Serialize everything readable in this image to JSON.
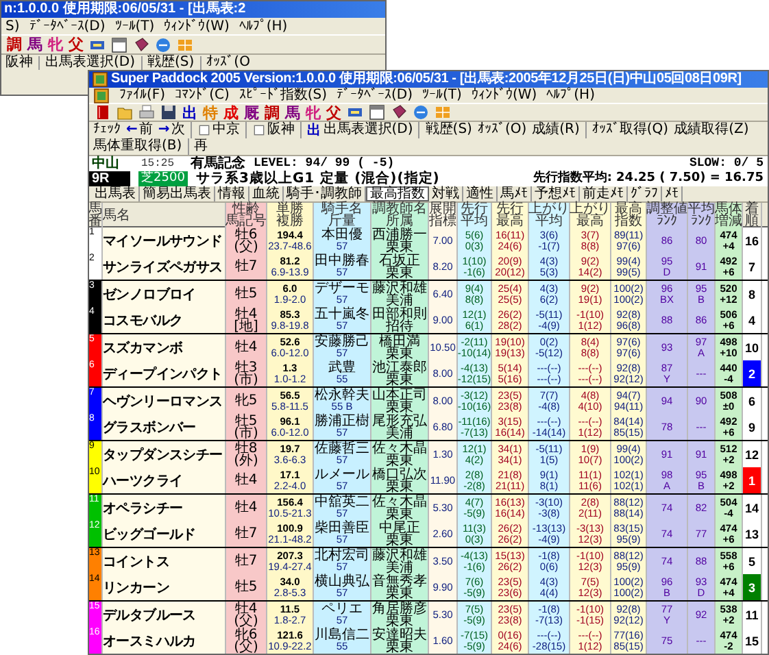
{
  "back_window": {
    "title": "n:1.0.0.0 使用期限:06/05/31 - [出馬表:2",
    "menu": [
      "S)",
      "ﾃﾞｰﾀﾍﾞｰｽ(D)",
      "ﾂｰﾙ(T)",
      "ｳｨﾝﾄﾞｳ(W)",
      "ﾍﾙﾌﾟ(H)"
    ],
    "toolbar": [
      {
        "text": "調",
        "color": "#c00000"
      },
      {
        "text": "馬",
        "color": "#800080"
      },
      {
        "text": "牝",
        "color": "#d02080"
      },
      {
        "text": "父",
        "color": "#c00000"
      }
    ],
    "toolbar2": [
      "阪神",
      "出馬表選択(D)",
      "戦歴(S)",
      "ｵｯｽﾞ(O"
    ]
  },
  "window": {
    "title": "Super Paddock 2005 Version:1.0.0.0 使用期限:06/05/31 - [出馬表:2005年12月25日(日)中山05回08日09R]",
    "menu": [
      "ﾌｧｲﾙ(F)",
      "ｺﾏﾝﾄﾞ(C)",
      "ｽﾋﾟｰﾄﾞ指数(S)",
      "ﾃﾞｰﾀﾍﾞｰｽ(D)",
      "ﾂｰﾙ(T)",
      "ｳｨﾝﾄﾞｳ(W)",
      "ﾍﾙﾌﾟ(H)"
    ],
    "toolbar": [
      {
        "text": "出",
        "color": "#0000c0"
      },
      {
        "text": "特",
        "color": "#e08000"
      },
      {
        "text": "成",
        "color": "#e00000"
      },
      {
        "text": "厩",
        "color": "#800080"
      },
      {
        "text": "調",
        "color": "#c00000"
      },
      {
        "text": "馬",
        "color": "#800080"
      },
      {
        "text": "牝",
        "color": "#d02080"
      },
      {
        "text": "父",
        "color": "#c00000"
      }
    ],
    "toolbar2": [
      {
        "kind": "plain",
        "text": "ﾁｪｯｸ",
        "separated": false
      },
      {
        "kind": "nav",
        "arrow": "←",
        "text": "前",
        "separated": false
      },
      {
        "kind": "nav",
        "arrow": "→",
        "text": "次",
        "separated": false
      },
      {
        "kind": "venue",
        "text": "中京",
        "separated": true
      },
      {
        "kind": "venue",
        "text": "阪神",
        "separated": true
      },
      {
        "kind": "select",
        "glyph": "出",
        "text": "出馬表選択(D)",
        "separated": true
      },
      {
        "kind": "plain",
        "text": "戦歴(S)",
        "separated": true
      },
      {
        "kind": "plain",
        "text": "ｵｯｽﾞ(O)",
        "separated": false
      },
      {
        "kind": "plain",
        "text": "成績(R)",
        "separated": false
      },
      {
        "kind": "plain",
        "text": "ｵｯｽﾞ取得(Q)",
        "separated": true
      },
      {
        "kind": "plain",
        "text": "成績取得(Z)",
        "separated": false
      },
      {
        "kind": "plain",
        "text": "馬体重取得(B)",
        "separated": false
      },
      {
        "kind": "plain",
        "text": "再",
        "separated": true
      }
    ],
    "info": {
      "venue": "中山",
      "time": "15:25",
      "race_name": "有馬記念",
      "level": "LEVEL: 94/ 99 ( -5)",
      "slow": "SLOW: 0/ 5",
      "race_no": "9R",
      "course": "芝2500",
      "condition": "サラ系3歳以上G1 定量 (混合)(指定)",
      "lead_index": "先行指数平均: 24.25 ( 7.50) = 16.75"
    },
    "tabs": [
      {
        "label": "出馬表",
        "selected": false
      },
      {
        "label": "簡易出馬表",
        "selected": false
      },
      {
        "label": "情報",
        "selected": false
      },
      {
        "label": "血統",
        "selected": false
      },
      {
        "label": "騎手･調教師",
        "selected": false
      },
      {
        "label": "最高指数",
        "selected": true
      },
      {
        "label": "対戦",
        "selected": false
      },
      {
        "label": "適性",
        "selected": false
      },
      {
        "label": "馬ﾒﾓ",
        "selected": false
      },
      {
        "label": "予想ﾒﾓ",
        "selected": false
      },
      {
        "label": "前走ﾒﾓ",
        "selected": false
      },
      {
        "label": "ｸﾞﾗﾌ",
        "selected": false
      },
      {
        "label": "ﾒﾓ",
        "selected": false
      }
    ],
    "table": {
      "columns": [
        [
          "馬",
          "番"
        ],
        [
          "馬名"
        ],
        [
          "性齢",
          "馬記号"
        ],
        [
          "単勝",
          "複勝"
        ],
        [
          "騎手名",
          "斤量"
        ],
        [
          "調教師名",
          "所属"
        ],
        [
          "展開",
          "指標"
        ],
        [
          "先行",
          "平均"
        ],
        [
          "先行",
          "最高"
        ],
        [
          "上がり",
          "平均"
        ],
        [
          "上がり",
          "最高"
        ],
        [
          "最高",
          "指数"
        ],
        [
          "調整値",
          "ﾗﾝｸ"
        ],
        [
          "平均",
          "ﾗﾝｸ"
        ],
        [
          "馬体",
          "増減"
        ],
        [
          "着",
          "順"
        ]
      ],
      "rows": [
        {
          "number": "1",
          "color": "#ffffff",
          "name": "マイソールサウンド",
          "sex_age": "牡6",
          "origin": "(父)",
          "odds_win": "194.4",
          "odds_place": "23.7-48.6",
          "jockey": "本田優",
          "weight": "57",
          "trainer": "西浦勝一",
          "stable": "栗東",
          "pace": "7.00",
          "lead_avg": [
            "5(6)",
            "0(3)"
          ],
          "lead_max": [
            "16(11)",
            "24(6)"
          ],
          "final_avg": [
            "3(6)",
            "-1(7)"
          ],
          "final_max": [
            "3(7)",
            "8(8)"
          ],
          "max_index": [
            "89(11)",
            "97(6)"
          ],
          "adj_rank": "86",
          "avg_rank": "80",
          "body_weight": "474",
          "weight_change": "+4",
          "finish": {
            "text": "16"
          }
        },
        {
          "number": "2",
          "color": "#ffffff",
          "name": "サンライズペガサス",
          "sex_age": "牡7",
          "odds_win": "81.2",
          "odds_place": "6.9-13.9",
          "jockey": "田中勝春",
          "weight": "57",
          "trainer": "石坂正",
          "stable": "栗東",
          "pace": "8.20",
          "lead_avg": [
            "1(10)",
            "-1(6)"
          ],
          "lead_max": [
            "20(9)",
            "20(12)"
          ],
          "final_avg": [
            "4(3)",
            "5(3)"
          ],
          "final_max": [
            "9(2)",
            "14(2)"
          ],
          "max_index": [
            "99(4)",
            "99(5)"
          ],
          "adj_rank": "95",
          "adj_grade": "D",
          "avg_rank": "91",
          "body_weight": "492",
          "weight_change": "+6",
          "finish": {
            "text": "7"
          }
        },
        {
          "number": "3",
          "color": "#000000",
          "name": "ゼンノロブロイ",
          "sex_age": "牡5",
          "odds_win": "6.0",
          "odds_place": "1.9-2.0",
          "jockey": "デザーモ",
          "weight": "57",
          "trainer": "藤沢和雄",
          "stable": "美浦",
          "pace": "6.40",
          "lead_avg": [
            "9(4)",
            "8(8)"
          ],
          "lead_max": [
            "25(4)",
            "25(5)"
          ],
          "final_avg": [
            "4(3)",
            "6(2)"
          ],
          "final_max": [
            "9(2)",
            "19(1)"
          ],
          "max_index": [
            "100(2)",
            "100(2)"
          ],
          "adj_rank": "96",
          "adj_grade": "BX",
          "avg_rank": "95",
          "avg_grade": "B",
          "body_weight": "520",
          "weight_change": "+12",
          "finish": {
            "text": "8"
          }
        },
        {
          "number": "4",
          "color": "#000000",
          "name": "コスモバルク",
          "sex_age": "牡4",
          "origin": "[地]",
          "odds_win": "85.3",
          "odds_place": "9.8-19.8",
          "jockey": "五十嵐冬",
          "weight": "57",
          "trainer": "田部和則",
          "stable": "招待",
          "pace": "9.00",
          "lead_avg": [
            "12(1)",
            "6(1)"
          ],
          "lead_max": [
            "26(2)",
            "28(2)"
          ],
          "final_avg": [
            "-5(11)",
            "-4(9)"
          ],
          "final_max": [
            "-1(10)",
            "1(12)"
          ],
          "max_index": [
            "92(8)",
            "96(8)"
          ],
          "adj_rank": "88",
          "avg_rank": "86",
          "body_weight": "506",
          "weight_change": "+6",
          "finish": {
            "text": "4"
          }
        },
        {
          "number": "5",
          "color": "#ff0000",
          "name": "スズカマンボ",
          "sex_age": "牡4",
          "odds_win": "52.6",
          "odds_place": "6.0-12.0",
          "jockey": "安藤勝己",
          "weight": "57",
          "trainer": "橋田満",
          "stable": "栗東",
          "pace": "10.50",
          "lead_avg": [
            "-2(11)",
            "-10(14)"
          ],
          "lead_max": [
            "19(10)",
            "19(13)"
          ],
          "final_avg": [
            "0(2)",
            "-5(12)"
          ],
          "final_max": [
            "8(4)",
            "8(8)"
          ],
          "max_index": [
            "97(6)",
            "97(6)"
          ],
          "adj_rank": "93",
          "avg_rank": "97",
          "avg_grade": "A",
          "body_weight": "498",
          "weight_change": "+10",
          "finish": {
            "text": "10"
          }
        },
        {
          "number": "6",
          "color": "#ff0000",
          "name": "ディープインパクト",
          "sex_age": "牡3",
          "origin": "(市)",
          "odds_win": "1.3",
          "odds_place": "1.0-1.2",
          "jockey": "武豊",
          "weight": "55",
          "trainer": "池江泰郎",
          "stable": "栗東",
          "pace": "8.00",
          "lead_avg": [
            "-4(13)",
            "-12(15)"
          ],
          "lead_max": [
            "5(14)",
            "5(16)"
          ],
          "final_avg": [
            "---(--)",
            "---(--)"
          ],
          "final_max": [
            "---(--)",
            "---(--)"
          ],
          "max_index": [
            "92(8)",
            "92(12)"
          ],
          "adj_rank": "87",
          "adj_grade": "Y",
          "avg_rank": "---",
          "body_weight": "440",
          "weight_change": "-4",
          "finish": {
            "text": "2",
            "color": "#0000ff"
          }
        },
        {
          "number": "7",
          "color": "#0000ff",
          "name": "ヘヴンリーロマンス",
          "sex_age": "牝5",
          "odds_win": "56.5",
          "odds_place": "5.8-11.5",
          "jockey": "松永幹夫",
          "weight": "55 B",
          "trainer": "山本正司",
          "stable": "栗東",
          "pace": "8.00",
          "lead_avg": [
            "-3(12)",
            "-10(16)"
          ],
          "lead_max": [
            "23(5)",
            "23(8)"
          ],
          "final_avg": [
            "7(7)",
            "-4(8)"
          ],
          "final_max": [
            "4(8)",
            "4(10)"
          ],
          "max_index": [
            "94(7)",
            "94(11)"
          ],
          "adj_rank": "94",
          "avg_rank": "90",
          "body_weight": "508",
          "weight_change": "±0",
          "finish": {
            "text": "6"
          }
        },
        {
          "number": "8",
          "color": "#0000ff",
          "name": "グラスボンバー",
          "sex_age": "牡5",
          "origin": "(市)",
          "odds_win": "96.1",
          "odds_place": "6.0-12.0",
          "jockey": "勝浦正樹",
          "weight": "57",
          "trainer": "尾形充弘",
          "stable": "美浦",
          "pace": "6.80",
          "lead_avg": [
            "-11(16)",
            "-7(13)"
          ],
          "lead_max": [
            "3(15)",
            "16(14)"
          ],
          "final_avg": [
            "---(--)",
            "-14(14)"
          ],
          "final_max": [
            "---(--)",
            "1(12)"
          ],
          "max_index": [
            "84(14)",
            "85(15)"
          ],
          "adj_rank": "78",
          "avg_rank": "---",
          "body_weight": "492",
          "weight_change": "+6",
          "finish": {
            "text": "9"
          }
        },
        {
          "number": "9",
          "color": "#ffff00",
          "name": "タップダンスシチー",
          "sex_age": "牡8",
          "origin": "(外)",
          "odds_win": "19.7",
          "odds_place": "3.6-6.3",
          "jockey": "佐藤哲三",
          "weight": "57",
          "trainer": "佐々木晶",
          "stable": "栗東",
          "pace": "1.30",
          "lead_avg": [
            "12(1)",
            "4(2)"
          ],
          "lead_max": [
            "34(1)",
            "34(1)"
          ],
          "final_avg": [
            "-5(11)",
            "1(5)"
          ],
          "final_max": [
            "1(9)",
            "10(7)"
          ],
          "max_index": [
            "99(4)",
            "100(2)"
          ],
          "adj_rank": "91",
          "avg_rank": "91",
          "body_weight": "512",
          "weight_change": "+2",
          "finish": {
            "text": "12"
          }
        },
        {
          "number": "10",
          "color": "#ffff00",
          "name": "ハーツクライ",
          "sex_age": "牡4",
          "odds_win": "17.1",
          "odds_place": "2.2-4.0",
          "jockey": "ルメール",
          "weight": "57",
          "trainer": "橋口弘次",
          "stable": "栗東",
          "pace": "11.90",
          "lead_avg": [
            "2(8)",
            "-2(8)"
          ],
          "lead_max": [
            "21(8)",
            "21(11)"
          ],
          "final_avg": [
            "9(1)",
            "8(1)"
          ],
          "final_max": [
            "11(1)",
            "11(6)"
          ],
          "max_index": [
            "102(1)",
            "102(1)"
          ],
          "adj_rank": "98",
          "adj_grade": "A",
          "avg_rank": "95",
          "avg_grade": "B",
          "body_weight": "498",
          "weight_change": "+2",
          "finish": {
            "text": "1",
            "color": "#ff0000"
          }
        },
        {
          "number": "11",
          "color": "#00c000",
          "name": "オペラシチー",
          "sex_age": "牡4",
          "odds_win": "156.4",
          "odds_place": "10.5-21.3",
          "jockey": "中舘英二",
          "weight": "57",
          "trainer": "佐々木晶",
          "stable": "栗東",
          "pace": "5.30",
          "lead_avg": [
            "4(7)",
            "-5(9)"
          ],
          "lead_max": [
            "16(13)",
            "16(14)"
          ],
          "final_avg": [
            "-3(10)",
            "-3(8)"
          ],
          "final_max": [
            "2(8)",
            "2(11)"
          ],
          "max_index": [
            "88(12)",
            "88(14)"
          ],
          "adj_rank": "74",
          "avg_rank": "82",
          "body_weight": "504",
          "weight_change": "-4",
          "finish": {
            "text": "14"
          }
        },
        {
          "number": "12",
          "color": "#00c000",
          "name": "ビッグゴールド",
          "sex_age": "牡7",
          "odds_win": "100.9",
          "odds_place": "21.1-48.2",
          "jockey": "柴田善臣",
          "weight": "57",
          "trainer": "中尾正",
          "stable": "栗東",
          "pace": "2.60",
          "lead_avg": [
            "11(3)",
            "0(3)"
          ],
          "lead_max": [
            "26(2)",
            "26(2)"
          ],
          "final_avg": [
            "-13(13)",
            "-4(9)"
          ],
          "final_max": [
            "-3(13)",
            "12(3)"
          ],
          "max_index": [
            "83(15)",
            "95(9)"
          ],
          "adj_rank": "74",
          "avg_rank": "77",
          "body_weight": "474",
          "weight_change": "+6",
          "finish": {
            "text": "13"
          }
        },
        {
          "number": "13",
          "color": "#ff8000",
          "name": "コイントス",
          "sex_age": "牡7",
          "odds_win": "207.3",
          "odds_place": "19.4-27.4",
          "jockey": "北村宏司",
          "weight": "57",
          "trainer": "藤沢和雄",
          "stable": "美浦",
          "pace": "3.50",
          "lead_avg": [
            "-4(13)",
            "-1(6)"
          ],
          "lead_max": [
            "15(13)",
            "26(2)"
          ],
          "final_avg": [
            "-1(8)",
            "0(6)"
          ],
          "final_max": [
            "-1(10)",
            "12(3)"
          ],
          "max_index": [
            "88(12)",
            "95(9)"
          ],
          "adj_rank": "74",
          "avg_rank": "88",
          "body_weight": "558",
          "weight_change": "+6",
          "finish": {
            "text": "5"
          }
        },
        {
          "number": "14",
          "color": "#ff8000",
          "name": "リンカーン",
          "sex_age": "牡5",
          "odds_win": "34.0",
          "odds_place": "2.8-5.3",
          "jockey": "横山典弘",
          "weight": "57",
          "trainer": "音無秀孝",
          "stable": "栗東",
          "pace": "9.90",
          "lead_avg": [
            "7(6)",
            "-5(9)"
          ],
          "lead_max": [
            "23(5)",
            "23(6)"
          ],
          "final_avg": [
            "4(3)",
            "4(4)"
          ],
          "final_max": [
            "7(5)",
            "12(3)"
          ],
          "max_index": [
            "100(2)",
            "100(2)"
          ],
          "adj_rank": "96",
          "adj_grade": "B",
          "avg_rank": "93",
          "avg_grade": "D",
          "body_weight": "474",
          "weight_change": "+4",
          "finish": {
            "text": "3",
            "color": "#008000"
          }
        },
        {
          "number": "15",
          "color": "#ff00ff",
          "name": "デルタブルース",
          "sex_age": "牡4",
          "origin": "(父)",
          "odds_win": "11.5",
          "odds_place": "1.8-2.7",
          "jockey": "ペリエ",
          "weight": "57",
          "trainer": "角居勝彦",
          "stable": "栗東",
          "pace": "5.30",
          "lead_avg": [
            "7(5)",
            "-5(9)"
          ],
          "lead_max": [
            "23(5)",
            "23(8)"
          ],
          "final_avg": [
            "-1(8)",
            "-7(13)"
          ],
          "final_max": [
            "-1(10)",
            "-1(15)"
          ],
          "max_index": [
            "92(8)",
            "92(12)"
          ],
          "adj_rank": "77",
          "adj_grade": "Y",
          "avg_rank": "92",
          "body_weight": "538",
          "weight_change": "+2",
          "finish": {
            "text": "11"
          }
        },
        {
          "number": "16",
          "color": "#ff00ff",
          "name": "オースミハルカ",
          "sex_age": "牝6",
          "origin": "(父)",
          "odds_win": "121.6",
          "odds_place": "10.9-22.2",
          "jockey": "川島信二",
          "weight": "55",
          "trainer": "安達昭夫",
          "stable": "栗東",
          "pace": "1.60",
          "lead_avg": [
            "-7(15)",
            "-5(9)"
          ],
          "lead_max": [
            "0(16)",
            "24(6)"
          ],
          "final_avg": [
            "---(--)",
            "-28(15)"
          ],
          "final_max": [
            "---(--)",
            "1(12)"
          ],
          "max_index": [
            "77(16)",
            "85(15)"
          ],
          "adj_rank": "75",
          "avg_rank": "---",
          "body_weight": "474",
          "weight_change": "-2",
          "finish": {
            "text": "15"
          }
        }
      ]
    }
  }
}
